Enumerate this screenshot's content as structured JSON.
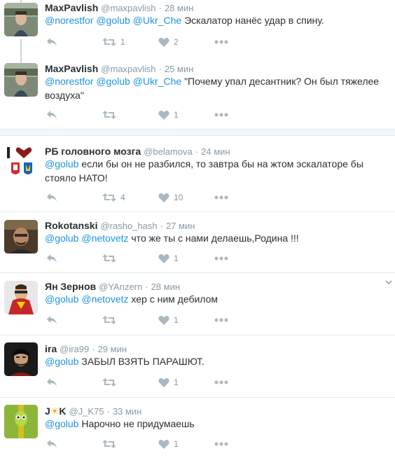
{
  "tweets": [
    {
      "name": "MaxPavlish",
      "handle": "@maxpavlish",
      "time": "28 мин",
      "mentions": "@norestfor @golub @Ukr_Che",
      "text": "Эскалатор нанёс удар в спину.",
      "retweets": "1",
      "likes": "2"
    },
    {
      "name": "MaxPavlish",
      "handle": "@maxpavlish",
      "time": "25 мин",
      "mentions": "@norestfor @golub @Ukr_Che",
      "text_line1": "\"Почему упал десантник? Он был тяжелее",
      "text_line2": "воздуха\"",
      "retweets": "",
      "likes": "1"
    },
    {
      "name": "РБ головного мозга",
      "handle": "@belamova",
      "time": "24 мин",
      "mentions": "@golub",
      "text_line1": "если бы он не разбился, то завтра бы на жтом эскалаторе бы",
      "text_line2": "стояло НАТО!",
      "retweets": "4",
      "likes": "10"
    },
    {
      "name": "Rokotanski",
      "handle": "@rasho_hash",
      "time": "27 мин",
      "mentions": "@golub @netovetz",
      "text": "что же ты с нами делаешь,Родина !!!",
      "retweets": "",
      "likes": "1"
    },
    {
      "name": "Ян Зернов",
      "handle": "@YAnzern",
      "time": "28 мин",
      "mentions": "@golub @netovetz",
      "text": "хер с ним дебилом",
      "retweets": "",
      "likes": "1"
    },
    {
      "name": "ira",
      "handle": "@ira99",
      "time": "29 мин",
      "mentions": "@golub",
      "text": "ЗАБЫЛ ВЗЯТЬ ПАРАШЮТ.",
      "retweets": "",
      "likes": "1"
    },
    {
      "name_prefix": "J",
      "name_suffix": "K",
      "handle": "@J_K75",
      "time": "33 мин",
      "mentions": "@golub",
      "text": "Нарочно не придумаешь",
      "retweets": "",
      "likes": "1"
    }
  ],
  "colors": {
    "link": "#1b95e0",
    "muted": "#8899a6",
    "icon": "#aab8c2",
    "border": "#e1e8ed"
  }
}
